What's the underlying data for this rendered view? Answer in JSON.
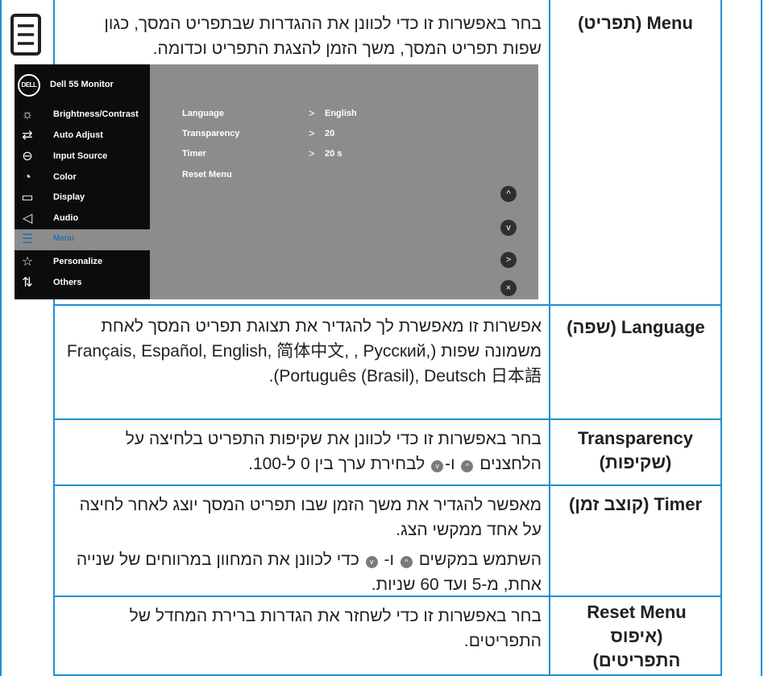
{
  "side_icon": "menu-list-icon",
  "colors": {
    "table_border": "#1f8fd0",
    "osd_background": "#8c8c8c",
    "osd_sidebar": "#0c0c0c",
    "osd_active": "#2b6ea8"
  },
  "rows": {
    "menu": {
      "name": "Menu (תפריט)",
      "description": "בחר באפשרות זו כדי לכוונן את ההגדרות שבתפריט המסך, כגון שפות תפריט המסך, משך הזמן להצגת התפריט וכדומה."
    },
    "language": {
      "name": "Language (שפה)",
      "description": "אפשרות זו מאפשרת לך להגדיר את תצוגת תפריט המסך לאחת משמונה שפות (Français, Español, English, 简体中文, , Pусский, Português (Brasil), Deutsch 日本語)."
    },
    "transparency": {
      "name": "Transparency (שקיפות)",
      "desc_part1": "בחר באפשרות זו כדי לכוונן את שקיפות התפריט בלחיצה על הלחצנים",
      "desc_part2": "ו-",
      "desc_part3": "לבחירת ערך בין 0 ל-100."
    },
    "timer": {
      "name": "Timer (קוצב זמן)",
      "desc_para1": "מאפשר להגדיר את משך הזמן שבו תפריט המסך יוצג לאחר לחיצה על אחד ממקשי הצג.",
      "desc_p2_part1": "השתמש במקשים",
      "desc_p2_part2": "ו-",
      "desc_p2_part3": "כדי לכוונן את המחוון במרווחים של שנייה אחת, מ-5 ועד 60 שניות."
    },
    "reset": {
      "name": "Reset Menu (איפוס התפריטים)",
      "description": "בחר באפשרות זו כדי לשחזר את הגדרות ברירת המחדל של התפריטים."
    }
  },
  "inline_buttons": {
    "up": "^",
    "down": "v"
  },
  "osd": {
    "brand": "DELL",
    "model": "Dell 55 Monitor",
    "menu_items": [
      {
        "label": "Brightness/Contrast",
        "icon": "brightness-icon",
        "glyph": "☼"
      },
      {
        "label": "Auto Adjust",
        "icon": "auto-adjust-icon",
        "glyph": "⇄"
      },
      {
        "label": "Input Source",
        "icon": "input-source-icon",
        "glyph": "⊖"
      },
      {
        "label": "Color",
        "icon": "color-icon",
        "glyph": "◔"
      },
      {
        "label": "Display",
        "icon": "display-icon",
        "glyph": "▭"
      },
      {
        "label": "Audio",
        "icon": "audio-icon",
        "glyph": "◁"
      },
      {
        "label": "Menu",
        "icon": "menu-icon",
        "glyph": "☰"
      },
      {
        "label": "Personalize",
        "icon": "personalize-icon",
        "glyph": "☆"
      },
      {
        "label": "Others",
        "icon": "others-icon",
        "glyph": "⇅"
      }
    ],
    "active_item": "Menu",
    "submenu": [
      {
        "label": "Language",
        "value": "English"
      },
      {
        "label": "Transparency",
        "value": "20"
      },
      {
        "label": "Timer",
        "value": "20 s"
      },
      {
        "label": "Reset Menu",
        "value": ""
      }
    ],
    "chevron": ">",
    "nav_buttons": [
      {
        "name": "up",
        "glyph": "^"
      },
      {
        "name": "down",
        "glyph": "v"
      },
      {
        "name": "right",
        "glyph": ">"
      },
      {
        "name": "exit",
        "glyph": "×"
      }
    ]
  }
}
